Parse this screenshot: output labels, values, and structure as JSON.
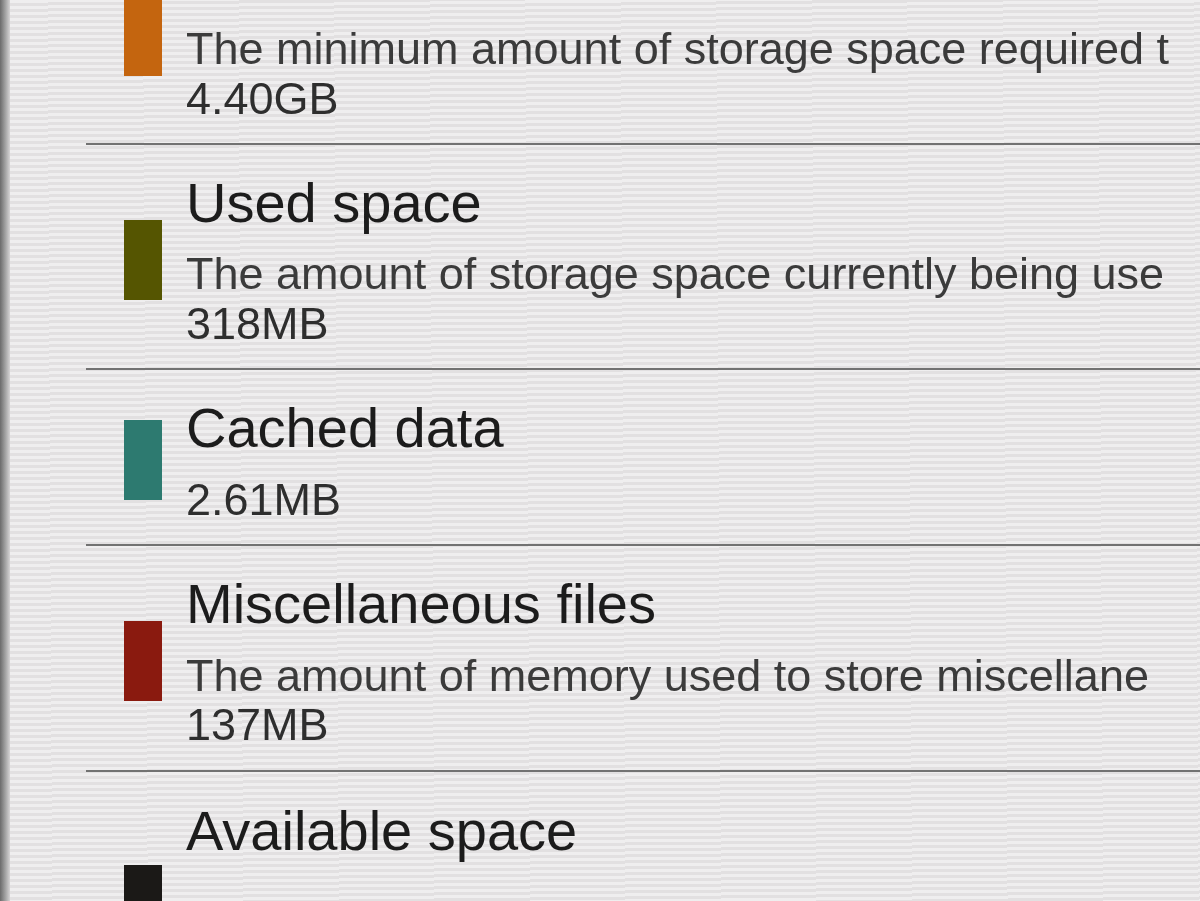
{
  "storage_items": [
    {
      "color": "#c4650f",
      "description": "The minimum amount of storage space required t",
      "value": "4.40GB"
    },
    {
      "title": "Used space",
      "color": "#555501",
      "description": "The amount of storage space currently being use",
      "value": "318MB"
    },
    {
      "title": "Cached data",
      "color": "#2d7a70",
      "value": "2.61MB"
    },
    {
      "title": "Miscellaneous files",
      "color": "#8a1a0f",
      "description": "The amount of memory used to store miscellane",
      "value": "137MB"
    },
    {
      "title": "Available space",
      "color": "#1b1917"
    }
  ]
}
